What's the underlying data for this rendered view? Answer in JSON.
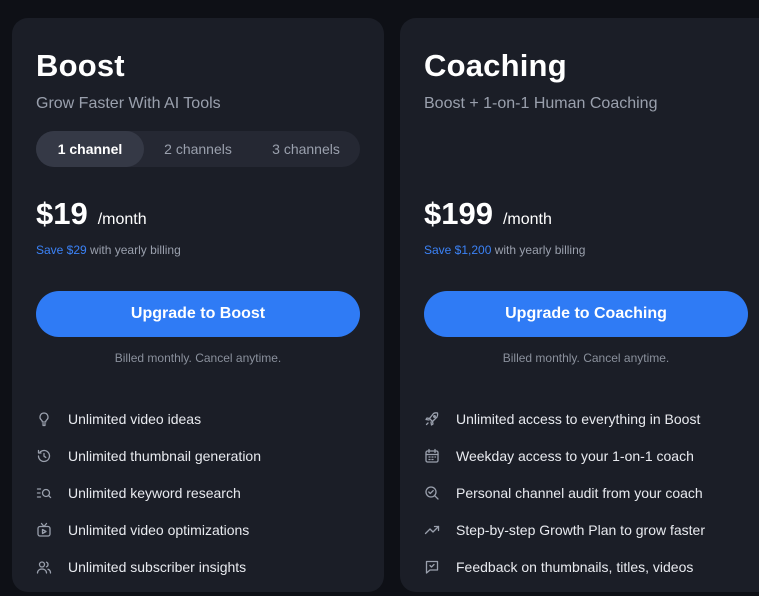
{
  "plans": {
    "boost": {
      "title": "Boost",
      "subtitle": "Grow Faster With AI Tools",
      "channel_options": [
        "1 channel",
        "2 channels",
        "3 channels"
      ],
      "selected_channel": "1 channel",
      "price": "$19",
      "period": "/month",
      "save_amount": "Save $29",
      "save_suffix": " with yearly billing",
      "cta_label": "Upgrade to Boost",
      "billing_note": "Billed monthly. Cancel anytime.",
      "features": [
        {
          "icon": "lightbulb-icon",
          "text": "Unlimited video ideas"
        },
        {
          "icon": "refresh-icon",
          "text": "Unlimited thumbnail generation"
        },
        {
          "icon": "list-search-icon",
          "text": "Unlimited keyword research"
        },
        {
          "icon": "video-optimize-icon",
          "text": "Unlimited video optimizations"
        },
        {
          "icon": "users-icon",
          "text": "Unlimited subscriber insights"
        }
      ]
    },
    "coaching": {
      "title": "Coaching",
      "subtitle": "Boost + 1-on-1 Human Coaching",
      "price": "$199",
      "period": "/month",
      "save_amount": "Save $1,200",
      "save_suffix": " with yearly billing",
      "cta_label": "Upgrade to Coaching",
      "billing_note": "Billed monthly. Cancel anytime.",
      "features": [
        {
          "icon": "rocket-icon",
          "text": "Unlimited access to everything in Boost"
        },
        {
          "icon": "calendar-icon",
          "text": "Weekday access to your 1-on-1 coach"
        },
        {
          "icon": "search-check-icon",
          "text": "Personal channel audit from your coach"
        },
        {
          "icon": "trending-up-icon",
          "text": "Step-by-step Growth Plan to grow faster"
        },
        {
          "icon": "message-icon",
          "text": "Feedback on thumbnails, titles, videos"
        }
      ]
    }
  },
  "colors": {
    "background": "#0e1016",
    "card": "#1b1e27",
    "accent": "#2f7bf5",
    "save_text": "#3b82f6",
    "muted_text": "#9aa0ad"
  }
}
